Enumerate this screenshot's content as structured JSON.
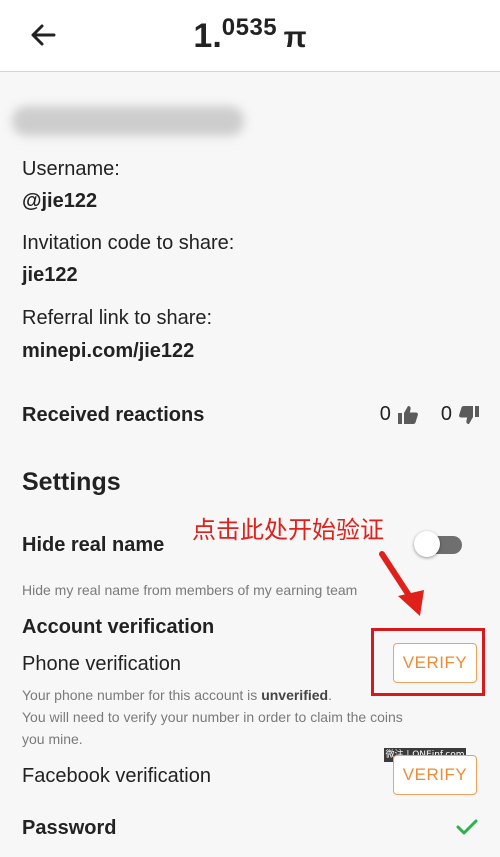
{
  "header": {
    "balance_int": "1.",
    "balance_frac": "0535",
    "balance_symbol": "π",
    "back_icon": "arrow-left-icon"
  },
  "profile": {
    "username_label": "Username:",
    "username_value": "@jie122",
    "invite_label": "Invitation code to share:",
    "invite_value": "jie122",
    "referral_label": "Referral link to share:",
    "referral_value": "minepi.com/jie122"
  },
  "reactions": {
    "label": "Received reactions",
    "likes": "0",
    "dislikes": "0",
    "like_icon": "thumbs-up-icon",
    "dislike_icon": "thumbs-down-icon"
  },
  "settings": {
    "title": "Settings",
    "hide_real_name_label": "Hide real name",
    "hide_real_name_desc": "Hide my real name from members of my earning team",
    "hide_real_name_on": false,
    "account_verification_title": "Account verification",
    "phone_label": "Phone verification",
    "phone_desc_prefix": "Your phone number for this account is ",
    "phone_desc_status": "unverified",
    "phone_desc_suffix": ".",
    "phone_desc_line2": "You will need to verify your number in order to claim the coins",
    "phone_desc_line3": "you mine.",
    "phone_button": "VERIFY",
    "facebook_label": "Facebook verification",
    "facebook_button": "VERIFY",
    "password_label": "Password",
    "password_icon": "checkmark-icon"
  },
  "annotation": {
    "text": "点击此处开始验证",
    "color": "#e0201b"
  },
  "watermark": {
    "text": "微注 | ONEinf.com"
  },
  "colors": {
    "accent_orange": "#ef8a34",
    "verify_border": "#f1a15a",
    "check_green": "#2bb24c",
    "annotation_red": "#d8191b"
  }
}
